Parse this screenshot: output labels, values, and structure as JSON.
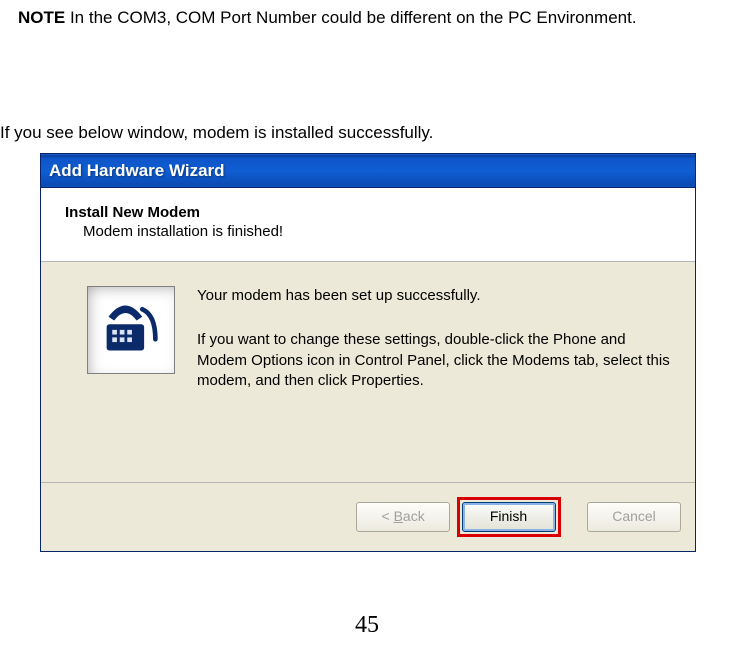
{
  "note": {
    "label": "NOTE",
    "text": "  In the COM3, COM Port Number could be different on the PC Environment."
  },
  "intro": "If you see below window, modem is installed successfully.",
  "wizard": {
    "title": "Add Hardware Wizard",
    "header": {
      "title": "Install New Modem",
      "subtitle": "Modem installation is finished!"
    },
    "body": {
      "line1": "Your modem has been set up successfully.",
      "line2": "If you want to change these settings, double-click the Phone and Modem Options icon in Control Panel, click the Modems tab, select this modem, and then click Properties."
    },
    "buttons": {
      "back_prefix": "< ",
      "back_mn": "B",
      "back_rest": "ack",
      "finish": "Finish",
      "cancel": "Cancel"
    }
  },
  "page_number": "45"
}
